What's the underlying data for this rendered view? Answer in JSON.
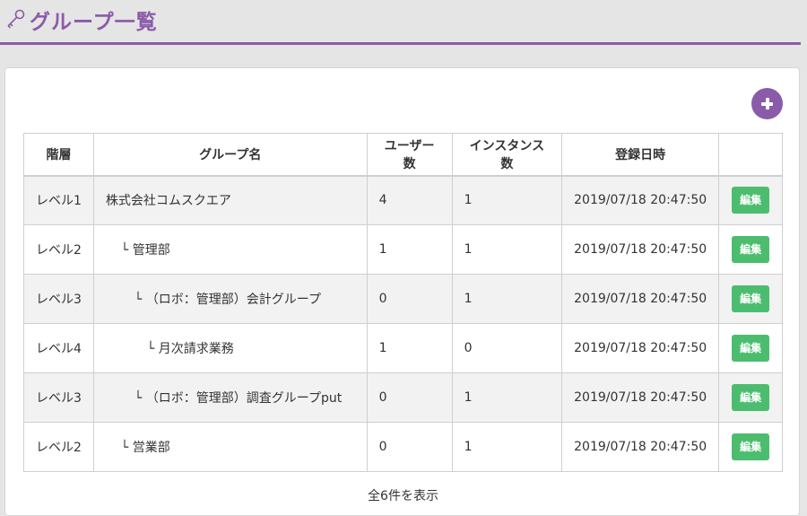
{
  "header": {
    "title": "グループ一覧",
    "icon": "key-icon",
    "accent": "#8a5ba8"
  },
  "toolbar": {
    "add_icon": "plus-icon"
  },
  "table": {
    "columns": [
      "階層",
      "グループ名",
      "ユーザー数",
      "インスタンス数",
      "登録日時",
      ""
    ],
    "rows": [
      {
        "level": "レベル1",
        "name": "株式会社コムスクエア",
        "users": "4",
        "instances": "1",
        "date": "2019/07/18 20:47:50",
        "action": "編集"
      },
      {
        "level": "レベル2",
        "name": "└ 管理部",
        "users": "1",
        "instances": "1",
        "date": "2019/07/18 20:47:50",
        "action": "編集"
      },
      {
        "level": "レベル3",
        "name": "└ （ロボ：管理部）会計グループ",
        "users": "0",
        "instances": "1",
        "date": "2019/07/18 20:47:50",
        "action": "編集"
      },
      {
        "level": "レベル4",
        "name": "└ 月次請求業務",
        "users": "1",
        "instances": "0",
        "date": "2019/07/18 20:47:50",
        "action": "編集"
      },
      {
        "level": "レベル3",
        "name": "└ （ロボ：管理部）調査グループput",
        "users": "0",
        "instances": "1",
        "date": "2019/07/18 20:47:50",
        "action": "編集"
      },
      {
        "level": "レベル2",
        "name": "└ 営業部",
        "users": "0",
        "instances": "1",
        "date": "2019/07/18 20:47:50",
        "action": "編集"
      }
    ]
  },
  "footer": {
    "count_text": "全6件を表示"
  },
  "colors": {
    "edit_button": "#4cbd6e",
    "row_alt": "#f2f2f2"
  }
}
